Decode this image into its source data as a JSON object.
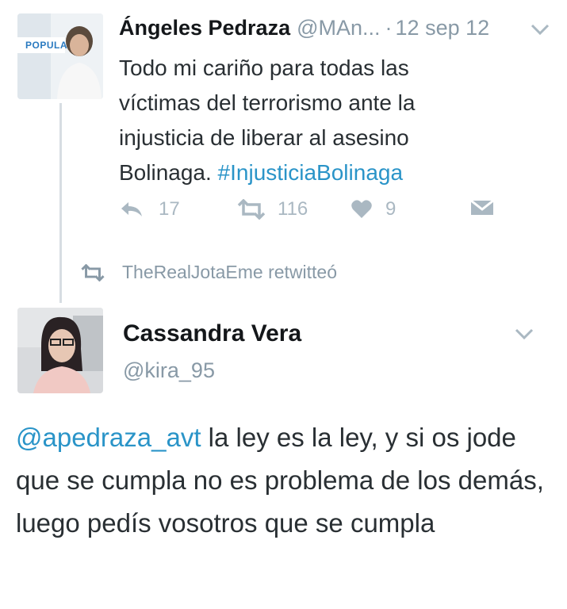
{
  "tweets": [
    {
      "name": "Ángeles Pedraza",
      "handle": "@MAn...",
      "separator": "·",
      "date": "12 sep 12",
      "avatar_text": "POPULA",
      "text_plain": "Todo mi cariño para todas las víctimas del terrorismo ante la injusticia de liberar al asesino Bolinaga. ",
      "hashtag": "#InjusticiaBolinaga",
      "replies": "17",
      "retweets": "116",
      "likes": "9",
      "icons": [
        "reply-icon",
        "retweet-icon",
        "heart-icon",
        "envelope-icon",
        "chevron-down-icon"
      ]
    },
    {
      "name": "Cassandra Vera",
      "handle": "@kira_95",
      "mention": "@apedraza_avt",
      "text_plain": " la ley es la ley, y si os jode que se cumpla no es problema de los demás, luego pedís vosotros que se cumpla"
    }
  ],
  "retweet_context": {
    "label": "TheRealJotaEme retwitteó"
  },
  "colors": {
    "link": "#2a94c8",
    "muted": "#8899a6",
    "icon": "#aab8c2",
    "thread_line": "#d7dde2"
  }
}
